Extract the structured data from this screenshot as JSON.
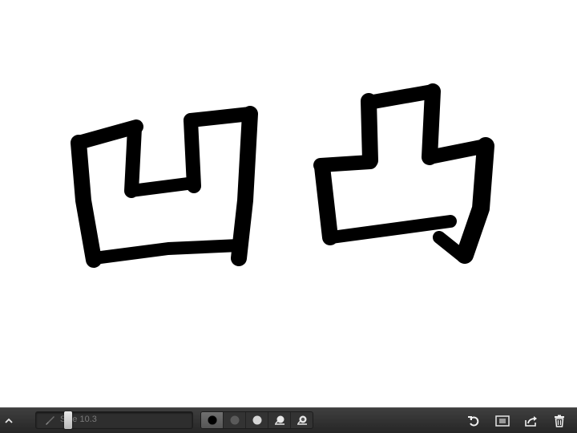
{
  "canvas": {
    "background": "#ffffff",
    "ink_color": "#000000"
  },
  "toolbar": {
    "collapse_icon": "chevron-up-icon",
    "brush_size_label": "Size 10.3",
    "brush_size_value": 10.3,
    "brush_icon": "brush-icon",
    "tools": [
      {
        "name": "black-ink",
        "icon": "black-dot-icon",
        "selected": true
      },
      {
        "name": "dark-gray-ink",
        "icon": "dark-gray-dot-icon",
        "selected": false
      },
      {
        "name": "light-gray-ink",
        "icon": "light-gray-dot-icon",
        "selected": false
      },
      {
        "name": "eraser",
        "icon": "eraser-icon",
        "selected": false
      },
      {
        "name": "smudge",
        "icon": "smudge-icon",
        "selected": false
      }
    ],
    "actions": [
      {
        "name": "undo",
        "icon": "undo-icon"
      },
      {
        "name": "reference",
        "icon": "reference-image-icon"
      },
      {
        "name": "share",
        "icon": "share-icon"
      },
      {
        "name": "delete",
        "icon": "trash-icon"
      }
    ]
  }
}
